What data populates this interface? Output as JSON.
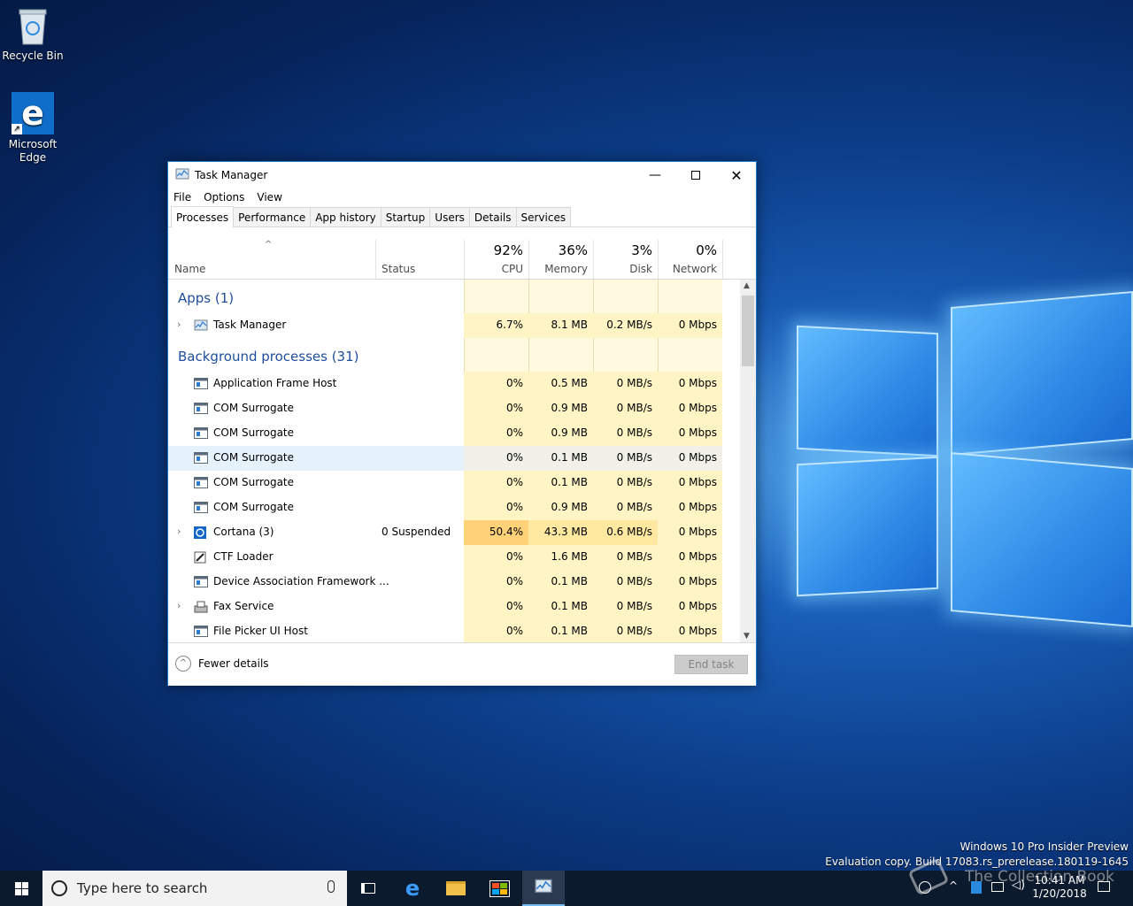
{
  "desktop": {
    "icons": [
      {
        "label": "Recycle Bin",
        "icon": "recycle-bin-icon"
      },
      {
        "label": "Microsoft Edge",
        "icon": "edge-icon"
      }
    ],
    "watermark": {
      "line1": "Windows 10 Pro Insider Preview",
      "line2": "Evaluation copy. Build 17083.rs_prerelease.180119-1645"
    }
  },
  "window": {
    "title": "Task Manager",
    "menu": [
      "File",
      "Options",
      "View"
    ],
    "tabs": [
      "Processes",
      "Performance",
      "App history",
      "Startup",
      "Users",
      "Details",
      "Services"
    ],
    "active_tab": "Processes",
    "columns": {
      "name": "Name",
      "status": "Status",
      "cpu": {
        "pct": "92%",
        "label": "CPU"
      },
      "memory": {
        "pct": "36%",
        "label": "Memory"
      },
      "disk": {
        "pct": "3%",
        "label": "Disk"
      },
      "network": {
        "pct": "0%",
        "label": "Network"
      }
    },
    "groups": {
      "apps": "Apps (1)",
      "background": "Background processes (31)"
    },
    "apps": [
      {
        "name": "Task Manager",
        "status": "",
        "cpu": "6.7%",
        "memory": "8.1 MB",
        "disk": "0.2 MB/s",
        "network": "0 Mbps",
        "expandable": true
      }
    ],
    "background": [
      {
        "name": "Application Frame Host",
        "status": "",
        "cpu": "0%",
        "memory": "0.5 MB",
        "disk": "0 MB/s",
        "network": "0 Mbps"
      },
      {
        "name": "COM Surrogate",
        "status": "",
        "cpu": "0%",
        "memory": "0.9 MB",
        "disk": "0 MB/s",
        "network": "0 Mbps"
      },
      {
        "name": "COM Surrogate",
        "status": "",
        "cpu": "0%",
        "memory": "0.9 MB",
        "disk": "0 MB/s",
        "network": "0 Mbps"
      },
      {
        "name": "COM Surrogate",
        "status": "",
        "cpu": "0%",
        "memory": "0.1 MB",
        "disk": "0 MB/s",
        "network": "0 Mbps"
      },
      {
        "name": "COM Surrogate",
        "status": "",
        "cpu": "0%",
        "memory": "0.1 MB",
        "disk": "0 MB/s",
        "network": "0 Mbps"
      },
      {
        "name": "COM Surrogate",
        "status": "",
        "cpu": "0%",
        "memory": "0.9 MB",
        "disk": "0 MB/s",
        "network": "0 Mbps"
      },
      {
        "name": "Cortana (3)",
        "status": "0 Suspended",
        "cpu": "50.4%",
        "memory": "43.3 MB",
        "disk": "0.6 MB/s",
        "network": "0 Mbps"
      },
      {
        "name": "CTF Loader",
        "status": "",
        "cpu": "0%",
        "memory": "1.6 MB",
        "disk": "0 MB/s",
        "network": "0 Mbps"
      },
      {
        "name": "Device Association Framework ...",
        "status": "",
        "cpu": "0%",
        "memory": "0.1 MB",
        "disk": "0 MB/s",
        "network": "0 Mbps"
      },
      {
        "name": "Fax Service",
        "status": "",
        "cpu": "0%",
        "memory": "0.1 MB",
        "disk": "0 MB/s",
        "network": "0 Mbps"
      },
      {
        "name": "File Picker UI Host",
        "status": "",
        "cpu": "0%",
        "memory": "0.1 MB",
        "disk": "0 MB/s",
        "network": "0 Mbps"
      }
    ],
    "footer": {
      "fewer_details": "Fewer details",
      "end_task": "End task"
    }
  },
  "taskbar": {
    "search_placeholder": "Type here to search",
    "clock_time": "10:41 AM",
    "clock_date": "1/20/2018",
    "overlay_text": "The Collection Book"
  },
  "colors": {
    "accent": "#1979ca",
    "heat_high": "#ffd27a",
    "heat_mid": "#ffe8a0",
    "heat_low": "#fff4c4",
    "group_text": "#1e4e9c"
  }
}
